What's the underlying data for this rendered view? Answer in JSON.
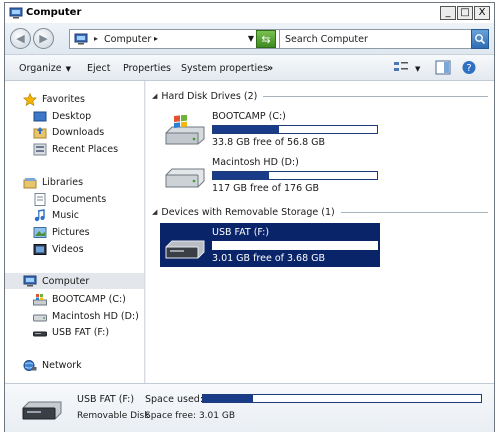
{
  "window": {
    "title": "Computer",
    "controls": [
      "_",
      "□",
      "X"
    ]
  },
  "address_bar": {
    "location": "Computer",
    "search_placeholder": "Search Computer"
  },
  "toolbar": {
    "organize": "Organize",
    "eject": "Eject",
    "properties": "Properties",
    "system_properties": "System properties",
    "more": "»"
  },
  "nav": {
    "favorites": {
      "label": "Favorites",
      "items": [
        {
          "label": "Desktop",
          "icon": "desktop-icon"
        },
        {
          "label": "Downloads",
          "icon": "downloads-icon"
        },
        {
          "label": "Recent Places",
          "icon": "recent-places-icon"
        }
      ]
    },
    "libraries": {
      "label": "Libraries",
      "items": [
        {
          "label": "Documents",
          "icon": "documents-icon"
        },
        {
          "label": "Music",
          "icon": "music-icon"
        },
        {
          "label": "Pictures",
          "icon": "pictures-icon"
        },
        {
          "label": "Videos",
          "icon": "videos-icon"
        }
      ]
    },
    "computer": {
      "label": "Computer",
      "items": [
        {
          "label": "BOOTCAMP (C:)",
          "icon": "windows-drive-icon"
        },
        {
          "label": "Macintosh HD (D:)",
          "icon": "hard-drive-icon"
        },
        {
          "label": "USB FAT (F:)",
          "icon": "usb-drive-icon"
        }
      ]
    },
    "network": {
      "label": "Network"
    }
  },
  "content": {
    "groups": [
      {
        "label": "Hard Disk Drives (2)",
        "drives": [
          {
            "name": "BOOTCAMP (C:)",
            "free_text": "33.8 GB free of 56.8 GB",
            "used_fraction": 0.4
          },
          {
            "name": "Macintosh HD (D:)",
            "free_text": "117 GB free of 176 GB",
            "used_fraction": 0.34
          }
        ]
      },
      {
        "label": "Devices with Removable Storage (1)",
        "drives": [
          {
            "name": "USB FAT (F:)",
            "free_text": "3.01 GB free of 3.68 GB",
            "used_fraction": 0.18
          }
        ]
      }
    ]
  },
  "details": {
    "name": "USB FAT (F:)",
    "type": "Removable Disk",
    "space_used_label": "Space used:",
    "space_free_label": "Space free:",
    "space_free_value": "3.01 GB",
    "used_fraction": 0.18
  },
  "colors": {
    "selection": "#0a246a",
    "bar_fill": "#1a3b88"
  }
}
